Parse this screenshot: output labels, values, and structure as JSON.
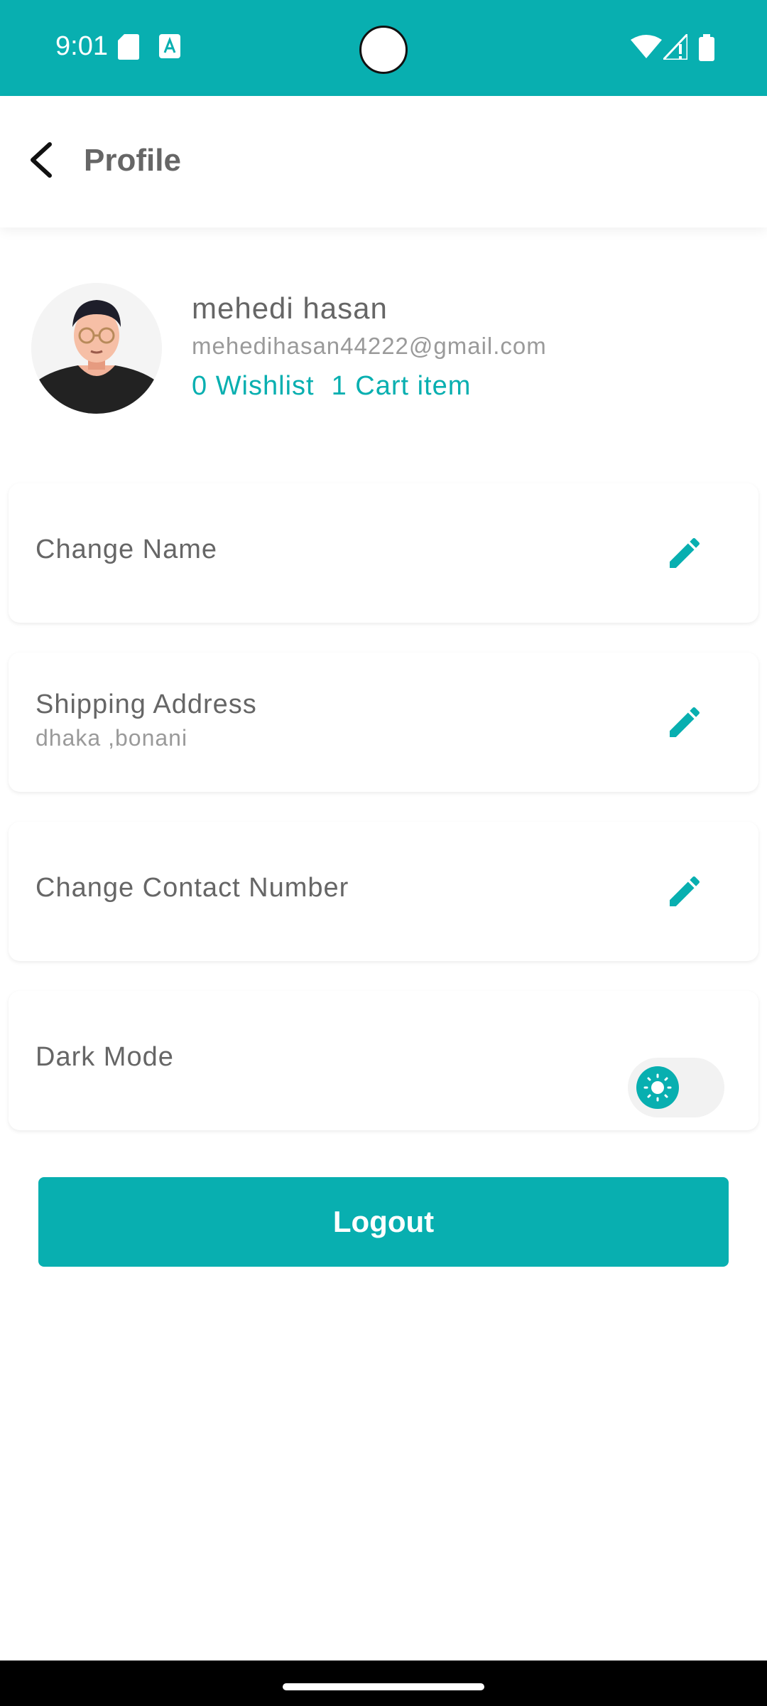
{
  "status_bar": {
    "time": "9:01",
    "icons": [
      "sd-card-icon",
      "keyboard-a-icon",
      "wifi-icon",
      "signal-icon",
      "battery-icon"
    ],
    "color": "#08afb0"
  },
  "app_bar": {
    "title": "Profile",
    "back_icon": "back-arrow-icon"
  },
  "profile": {
    "name": "mehedi hasan",
    "email": "mehedihasan44222@gmail.com",
    "wishlist": "0 Wishlist",
    "cart": "1 Cart item"
  },
  "settings": {
    "change_name": "Change Name",
    "shipping_address": "Shipping Address",
    "shipping_value": "dhaka ,bonani",
    "change_contact": "Change Contact Number",
    "dark_mode": "Dark Mode",
    "dark_mode_on": false
  },
  "actions": {
    "logout": "Logout"
  },
  "colors": {
    "accent": "#08afb0",
    "text": "#666666",
    "muted": "#9a9a9a"
  }
}
